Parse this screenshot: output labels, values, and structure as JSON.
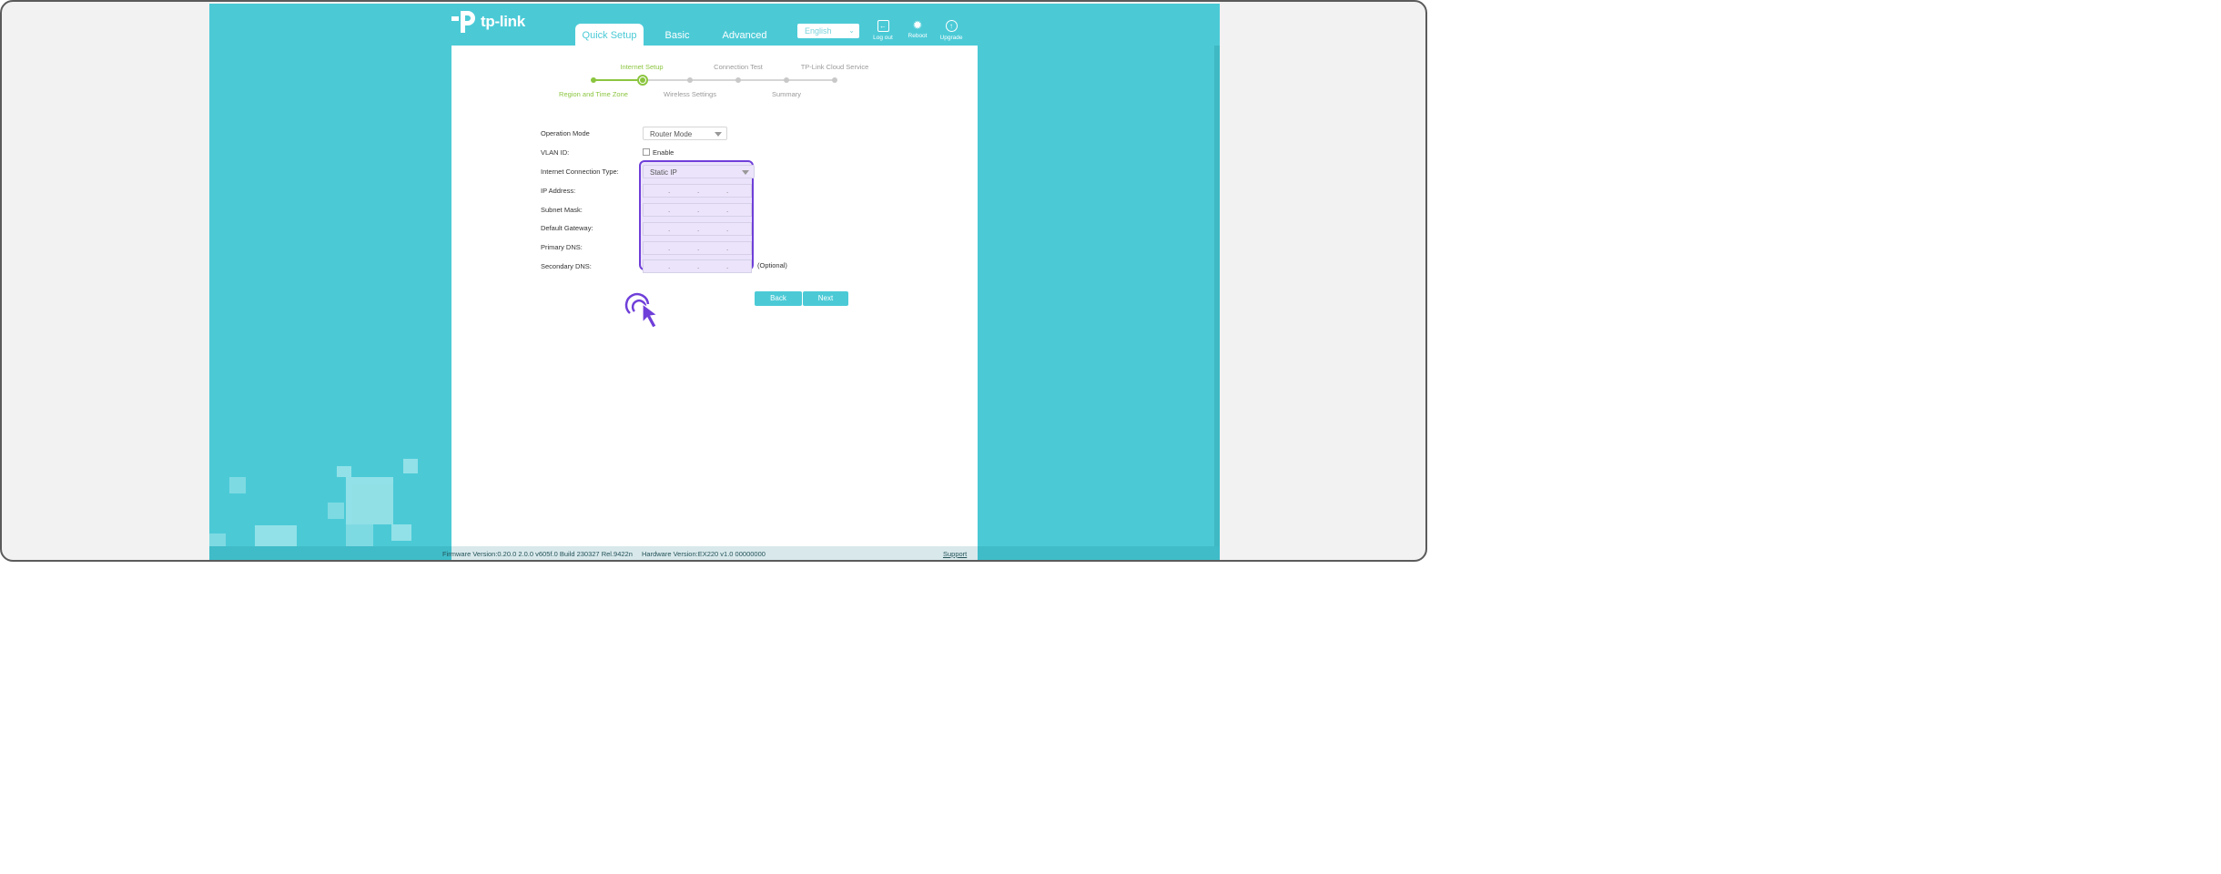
{
  "brand": {
    "logo_text": "tp-link",
    "logo_icon": "tp-link-logo-icon"
  },
  "nav": {
    "tabs": [
      {
        "label": "Quick Setup",
        "active": true
      },
      {
        "label": "Basic",
        "active": false
      },
      {
        "label": "Advanced",
        "active": false
      }
    ],
    "language": "English",
    "actions": [
      {
        "label": "Log out",
        "icon": "logout-icon"
      },
      {
        "label": "Reboot",
        "icon": "reboot-icon"
      },
      {
        "label": "Upgrade",
        "icon": "upgrade-icon"
      }
    ]
  },
  "wizard": {
    "steps_top": [
      "Internet Setup",
      "Connection Test",
      "TP-Link Cloud Service"
    ],
    "steps_bottom": [
      "Region and Time Zone",
      "Wireless Settings",
      "Summary"
    ],
    "current_step": "Internet Setup",
    "completed_step": "Region and Time Zone"
  },
  "form": {
    "operation_mode": {
      "label": "Operation Mode",
      "value": "Router Mode"
    },
    "vlan": {
      "label": "VLAN ID:",
      "checkbox_label": "Enable",
      "checked": false
    },
    "connection_type": {
      "label": "Internet Connection Type:",
      "value": "Static IP"
    },
    "ip_address": {
      "label": "IP Address:"
    },
    "subnet_mask": {
      "label": "Subnet Mask:"
    },
    "default_gateway": {
      "label": "Default Gateway:"
    },
    "primary_dns": {
      "label": "Primary DNS:"
    },
    "secondary_dns": {
      "label": "Secondary DNS:",
      "note": "(Optional)"
    }
  },
  "buttons": {
    "back": "Back",
    "next": "Next"
  },
  "footer": {
    "firmware": "Firmware Version:0.20.0 2.0.0 v605f.0 Build 230327 Rel.9422n",
    "hardware": "Hardware Version:EX220 v1.0 00000000",
    "support": "Support"
  },
  "colors": {
    "accent": "#4bcad6",
    "progress": "#8bc53f",
    "highlight": "#6f3fd9"
  }
}
